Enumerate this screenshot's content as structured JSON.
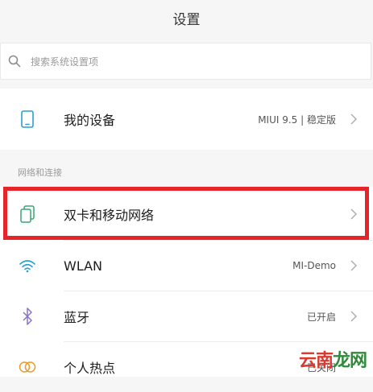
{
  "title": "设置",
  "search": {
    "placeholder": "搜索系统设置项",
    "icon": "search-icon"
  },
  "my_device": {
    "label": "我的设备",
    "value": "MIUI 9.5 | 稳定版",
    "icon": "phone-icon"
  },
  "network_section": {
    "header": "网络和连接",
    "items": [
      {
        "label": "双卡和移动网络",
        "value": "",
        "icon": "dual-sim-icon",
        "icon_color": "#3aa573"
      },
      {
        "label": "WLAN",
        "value": "MI-Demo",
        "icon": "wifi-icon",
        "icon_color": "#2a9fd6"
      },
      {
        "label": "蓝牙",
        "value": "已开启",
        "icon": "bluetooth-icon",
        "icon_color": "#8a73c9"
      },
      {
        "label": "个人热点",
        "value": "已关闭",
        "icon": "hotspot-icon",
        "icon_color": "#e89a2c"
      }
    ]
  },
  "highlight_color": "#e4252a",
  "watermark": {
    "part1": "云南",
    "part2": "龙网"
  }
}
